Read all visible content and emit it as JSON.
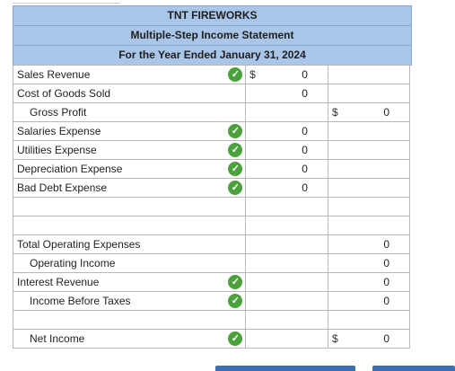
{
  "header": {
    "company": "TNT FIREWORKS",
    "statement": "Multiple-Step Income Statement",
    "period": "For the Year Ended January 31, 2024"
  },
  "rows": [
    {
      "label": "Sales Revenue",
      "indent": false,
      "check": true,
      "c1_cur": "$",
      "c1_val": "0",
      "c2_cur": "",
      "c2_val": ""
    },
    {
      "label": "Cost of Goods Sold",
      "indent": false,
      "check": false,
      "c1_cur": "",
      "c1_val": "0",
      "c2_cur": "",
      "c2_val": ""
    },
    {
      "label": "Gross Profit",
      "indent": true,
      "check": false,
      "c1_cur": "",
      "c1_val": "",
      "c2_cur": "$",
      "c2_val": "0"
    },
    {
      "label": "Salaries Expense",
      "indent": false,
      "check": true,
      "c1_cur": "",
      "c1_val": "0",
      "c2_cur": "",
      "c2_val": ""
    },
    {
      "label": "Utilities Expense",
      "indent": false,
      "check": true,
      "c1_cur": "",
      "c1_val": "0",
      "c2_cur": "",
      "c2_val": ""
    },
    {
      "label": "Depreciation Expense",
      "indent": false,
      "check": true,
      "c1_cur": "",
      "c1_val": "0",
      "c2_cur": "",
      "c2_val": ""
    },
    {
      "label": "Bad Debt Expense",
      "indent": false,
      "check": true,
      "c1_cur": "",
      "c1_val": "0",
      "c2_cur": "",
      "c2_val": ""
    },
    {
      "label": "",
      "indent": false,
      "check": false,
      "c1_cur": "",
      "c1_val": "",
      "c2_cur": "",
      "c2_val": ""
    },
    {
      "label": "",
      "indent": false,
      "check": false,
      "c1_cur": "",
      "c1_val": "",
      "c2_cur": "",
      "c2_val": ""
    },
    {
      "label": "Total Operating Expenses",
      "indent": false,
      "check": false,
      "c1_cur": "",
      "c1_val": "",
      "c2_cur": "",
      "c2_val": "0"
    },
    {
      "label": "Operating Income",
      "indent": true,
      "check": false,
      "c1_cur": "",
      "c1_val": "",
      "c2_cur": "",
      "c2_val": "0"
    },
    {
      "label": "Interest Revenue",
      "indent": false,
      "check": true,
      "c1_cur": "",
      "c1_val": "",
      "c2_cur": "",
      "c2_val": "0"
    },
    {
      "label": "Income Before Taxes",
      "indent": true,
      "check": true,
      "c1_cur": "",
      "c1_val": "",
      "c2_cur": "",
      "c2_val": "0"
    },
    {
      "label": "",
      "indent": false,
      "check": false,
      "c1_cur": "",
      "c1_val": "",
      "c2_cur": "",
      "c2_val": ""
    },
    {
      "label": "Net Income",
      "indent": true,
      "check": true,
      "c1_cur": "",
      "c1_val": "",
      "c2_cur": "$",
      "c2_val": "0"
    }
  ],
  "check_glyph": "✓",
  "colors": {
    "header_bg": "#a9c6e8",
    "check_green": "#4ba13b",
    "button_blue": "#3a6fb5"
  }
}
